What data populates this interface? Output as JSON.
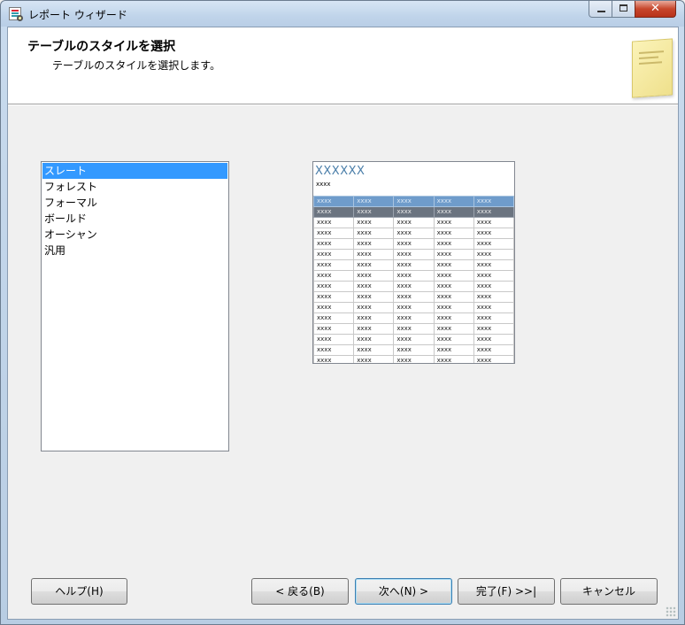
{
  "window": {
    "title": "レポート ウィザード",
    "close_glyph": "✕"
  },
  "header": {
    "title": "テーブルのスタイルを選択",
    "subtitle": "テーブルのスタイルを選択します。"
  },
  "style_list": {
    "selected_index": 0,
    "items": [
      "スレート",
      "フォレスト",
      "フォーマル",
      "ボールド",
      "オーシャン",
      "汎用"
    ]
  },
  "preview": {
    "title": "XXXXXX",
    "subtitle": "xxxx",
    "cell_text": "xxxx",
    "columns": 5,
    "data_rows": 14
  },
  "buttons": {
    "help": "ヘルプ(H)",
    "back": "< 戻る(B)",
    "next": "次へ(N) >",
    "finish": "完了(F) >>|",
    "cancel": "キャンセル"
  },
  "colors": {
    "selection": "#3399ff",
    "preview_header": "#6f9ccb",
    "preview_header2": "#6b7480",
    "preview_title": "#4a7ea9"
  }
}
